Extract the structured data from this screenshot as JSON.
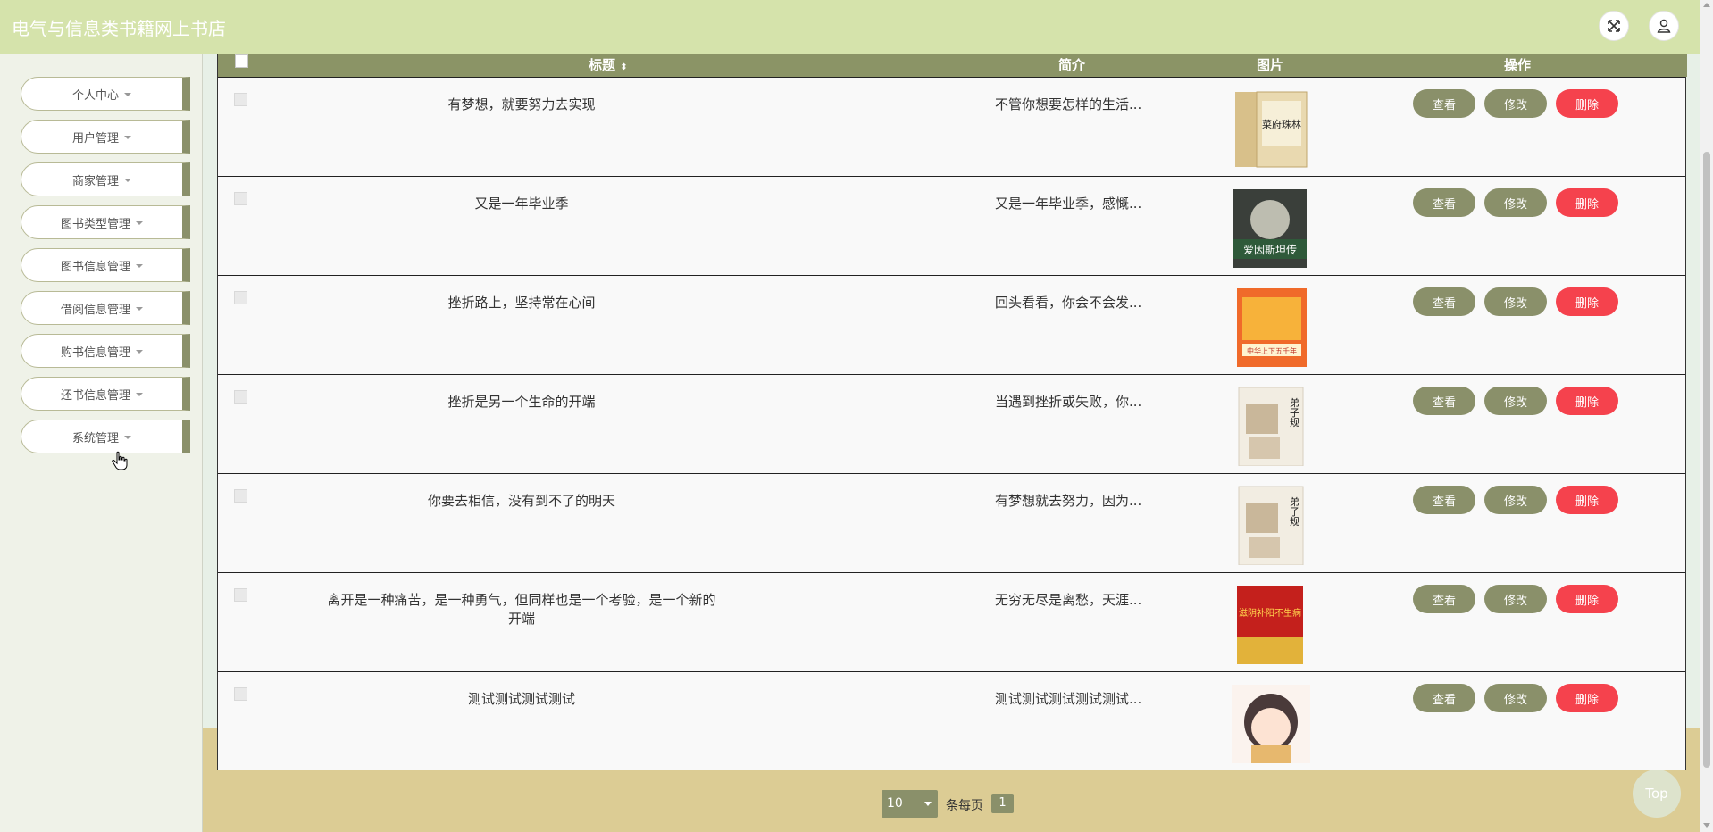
{
  "app": {
    "title": "电气与信息类书籍网上书店"
  },
  "topbar": {
    "fullscreen_icon": "fullscreen-icon",
    "user_icon": "user-icon"
  },
  "sidebar": {
    "items": [
      {
        "label": "个人中心"
      },
      {
        "label": "用户管理"
      },
      {
        "label": "商家管理"
      },
      {
        "label": "图书类型管理"
      },
      {
        "label": "图书信息管理"
      },
      {
        "label": "借阅信息管理"
      },
      {
        "label": "购书信息管理"
      },
      {
        "label": "还书信息管理"
      },
      {
        "label": "系统管理"
      }
    ]
  },
  "table": {
    "headers": {
      "title": "标题",
      "intro": "简介",
      "image": "图片",
      "actions": "操作"
    },
    "buttons": {
      "view": "查看",
      "edit": "修改",
      "delete": "删除"
    },
    "rows": [
      {
        "title": "有梦想，就要努力去实现",
        "intro": "不管你想要怎样的生活...",
        "cover": "菜府珠林"
      },
      {
        "title": "又是一年毕业季",
        "intro": "又是一年毕业季，感慨...",
        "cover": "爱因斯坦传"
      },
      {
        "title": "挫折路上，坚持常在心间",
        "intro": "回头看看，你会不会发...",
        "cover": "中华上下五千年"
      },
      {
        "title": "挫折是另一个生命的开端",
        "intro": "当遇到挫折或失败，你...",
        "cover": "弟子规"
      },
      {
        "title": "你要去相信，没有到不了的明天",
        "intro": "有梦想就去努力，因为...",
        "cover": "弟子规"
      },
      {
        "title": "离开是一种痛苦，是一种勇气，但同样也是一个考验，是一个新的开端",
        "intro": "无穷无尽是离愁，天涯...",
        "cover": "滋阴补阳不生病"
      },
      {
        "title": "测试测试测试测试",
        "intro": "测试测试测试测试测试...",
        "cover": ""
      }
    ]
  },
  "pagination": {
    "page_size": "10",
    "per_page_label": "条每页",
    "current_page": "1"
  },
  "back_to_top": {
    "label": "Top"
  }
}
